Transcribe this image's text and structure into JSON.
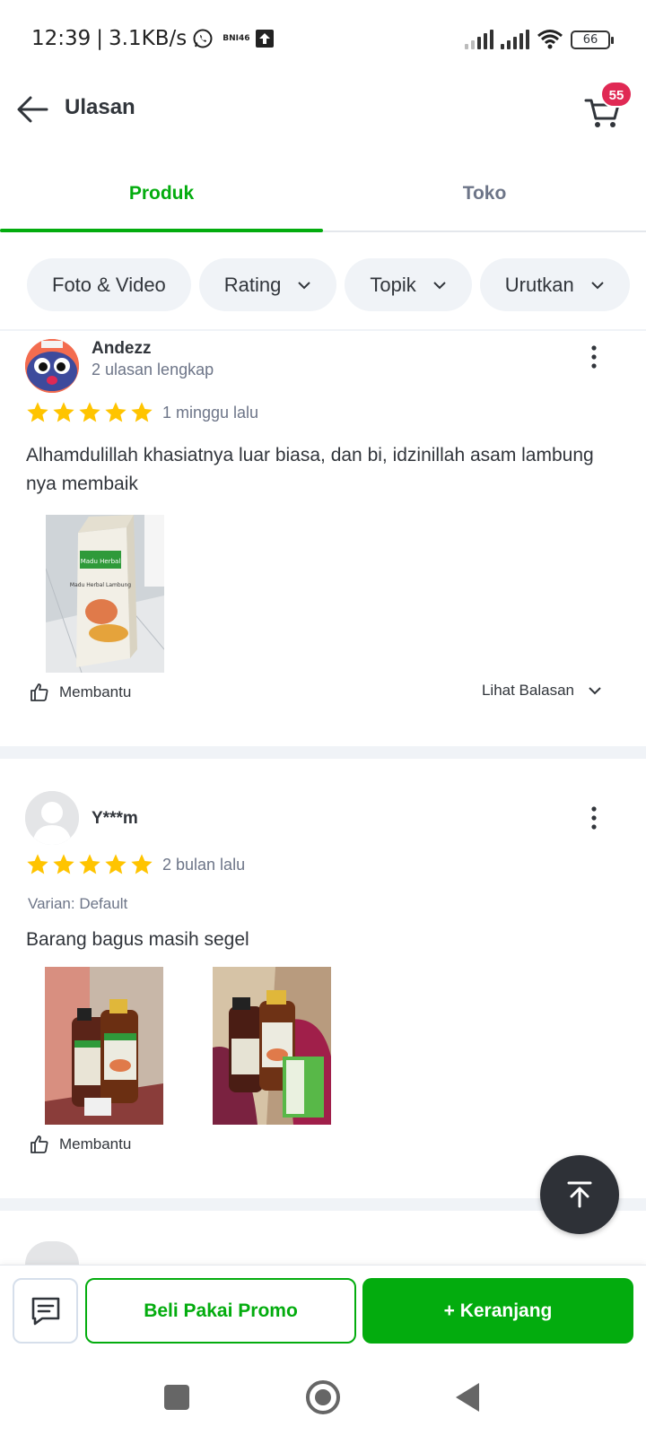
{
  "status_bar": {
    "time": "12:39",
    "speed": "3.1KB/s",
    "carrier_tag": "BNI46",
    "battery": "66"
  },
  "header": {
    "title": "Ulasan",
    "cart_count": "55"
  },
  "tabs": [
    {
      "label": "Produk",
      "active": true
    },
    {
      "label": "Toko",
      "active": false
    }
  ],
  "filters": {
    "photo_video": "Foto & Video",
    "rating": "Rating",
    "topic": "Topik",
    "sort": "Urutkan"
  },
  "reviews": [
    {
      "name": "Andezz",
      "subtitle": "2 ulasan lengkap",
      "stars": 5,
      "time": "1 minggu lalu",
      "text": "Alhamdulillah khasiatnya luar biasa, dan bi, idzinillah asam lambung nya membaik",
      "helpful": "Membantu",
      "replies": "Lihat Balasan",
      "photo_labels": [
        "Madu Herbal Lambung"
      ]
    },
    {
      "name": "Y***m",
      "stars": 5,
      "time": "2 bulan lalu",
      "variant": "Varian: Default",
      "text": "Barang bagus masih segel",
      "helpful": "Membantu"
    }
  ],
  "actions": {
    "promo": "Beli Pakai Promo",
    "cart": "+ Keranjang"
  },
  "colors": {
    "accent": "#03ac0e",
    "star": "#ffc400",
    "badge": "#e02954"
  }
}
